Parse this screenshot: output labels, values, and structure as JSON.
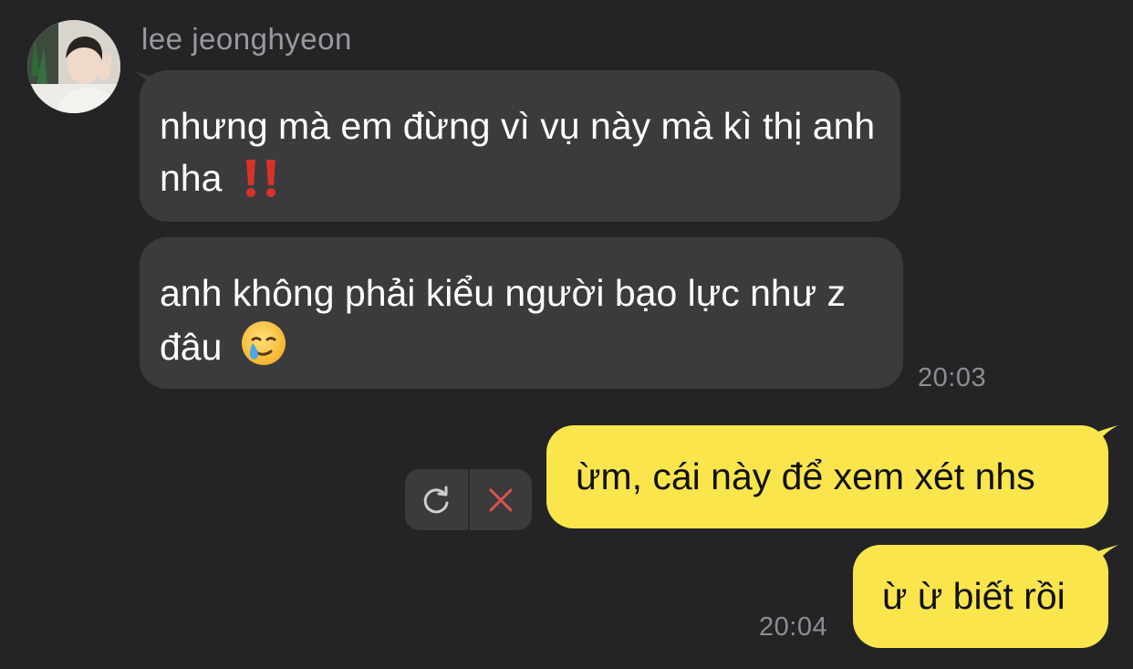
{
  "chat": {
    "sender_name": "lee jeonghyeon",
    "incoming": [
      {
        "text": "nhưng mà em đừng vì vụ này mà kì thị anh nha",
        "emoji": "double-exclamation-icon"
      },
      {
        "text": "anh không phải kiểu người bạo lực như z đâu",
        "emoji": "crying-smile-emoji"
      }
    ],
    "incoming_time": "20:03",
    "outgoing": [
      {
        "text": "ừm, cái này để xem xét nhs"
      },
      {
        "text": "ừ ừ biết rồi"
      }
    ],
    "outgoing_time": "20:04",
    "failed_actions": {
      "retry_icon": "retry-icon",
      "cancel_icon": "close-icon"
    }
  },
  "colors": {
    "background": "#242426",
    "incoming_bubble": "#3b3b3e",
    "outgoing_bubble": "#fbe54d",
    "cancel_red": "#e0524c"
  }
}
